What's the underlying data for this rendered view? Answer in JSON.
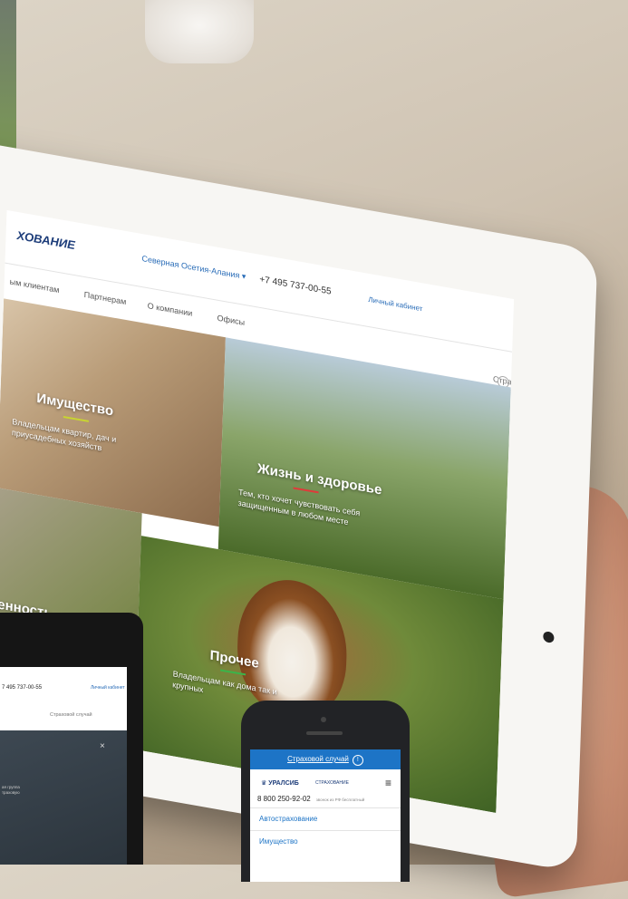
{
  "tablet_site": {
    "logo": "ХОВАНИЕ",
    "region": "Северная Осетия-Алания ▾",
    "phone": "+7 495 737-00-55",
    "cabinet": "Личный кабинет",
    "nav": [
      "ым клиентам",
      "Партнерам",
      "О компании",
      "Офисы"
    ],
    "claim": "Страховой случай",
    "claim_icon": "!",
    "tiles": {
      "property": {
        "title": "Имущество",
        "desc": "Владельцам квартир, дач и приусадебных хозяйств",
        "line_color": "#c8d431"
      },
      "life": {
        "title": "Жизнь и здоровье",
        "desc": "Тем, кто хочет чувствовать себя защищенным в любом месте",
        "line_color": "#e03a3a"
      },
      "responsibility": {
        "title": "венность"
      },
      "other": {
        "title": "Прочее",
        "desc": "Владельцам как дома так и крупных",
        "line_color": "#3ab54a"
      }
    }
  },
  "laptop_site": {
    "phone": "7 495 737-00-55",
    "cabinet": "Личный кабинет",
    "claim": "Страховой случай",
    "close": "×",
    "text_line1": "ая группа",
    "text_line2": "траховую"
  },
  "phone_site": {
    "claim_bar": "Страховой случай",
    "claim_icon": "!",
    "logo": "УРАЛСИБ",
    "logo_sub": "СТРАХОВАНИЕ",
    "menu_icon": "≡",
    "hotline": "8 800 250-92-02",
    "hotline_note": "звонок из РФ бесплатный",
    "menu_items": [
      "Автострахование",
      "Имущество"
    ]
  }
}
